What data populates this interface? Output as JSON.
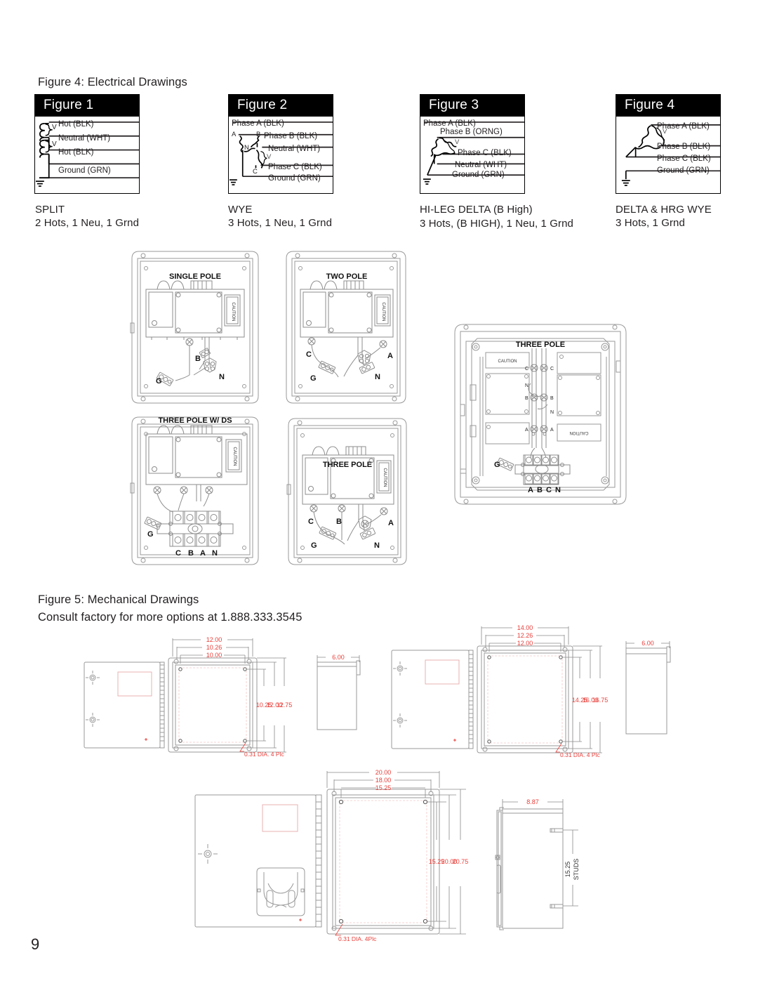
{
  "page": {
    "number": "9"
  },
  "figure4": {
    "caption": "Figure 4:  Electrical Drawings",
    "cards": [
      {
        "header": "Figure 1",
        "wires": [
          "Hot (BLK)",
          "Neutral (WHT)",
          "Hot (BLK)",
          "Ground (GRN)"
        ],
        "coil_marks": [
          "V",
          "V"
        ],
        "name": "SPLIT",
        "desc": "2 Hots, 1 Neu, 1 Grnd"
      },
      {
        "header": "Figure 2",
        "wires": [
          "Phase A (BLK)",
          "Phase B (BLK)",
          "Neutral (WHT)",
          "Phase C (BLK)",
          "Ground (GRN)"
        ],
        "node_marks": [
          "A",
          "B",
          "N",
          "C"
        ],
        "coil_marks": [
          "V"
        ],
        "name": "WYE",
        "desc": "3 Hots, 1 Neu, 1 Grnd"
      },
      {
        "header": "Figure 3",
        "wires": [
          "Phase A (BLK)",
          "Phase B (ORNG)",
          "Phase C (BLK)",
          "Neutral (WHT)",
          "Ground (GRN)"
        ],
        "coil_marks": [
          "V"
        ],
        "name": "HI-LEG DELTA (B High)",
        "desc": "3  Hots,  (B  HIGH),\n1 Neu, 1 Grnd"
      },
      {
        "header": "Figure 4",
        "wires": [
          "Phase A (BLK)",
          "Phase B (BLK)",
          "Phase C (BLK)",
          "Ground (GRN)"
        ],
        "coil_marks": [
          "V"
        ],
        "name": "DELTA & HRG WYE",
        "desc": "3 Hots, 1 Grnd"
      }
    ]
  },
  "panels": [
    {
      "title": "SINGLE POLE",
      "terminals": [
        "B"
      ],
      "ground": "G",
      "neutral": "N",
      "caution": "CAUTION"
    },
    {
      "title": "TWO POLE",
      "terminals": [
        "C",
        "A"
      ],
      "ground": "G",
      "neutral": "N",
      "caution": "CAUTION"
    },
    {
      "title": "THREE POLE W/ DS",
      "terminals": [
        "C",
        "B",
        "A",
        "N"
      ],
      "ground": "G",
      "neutral": "",
      "caution": "CAUTION"
    },
    {
      "title": "THREE POLE",
      "terminals": [
        "C",
        "B",
        "A"
      ],
      "ground": "G",
      "neutral": "N",
      "caution": "CAUTION"
    },
    {
      "title": "THREE POLE",
      "terminals": [
        "A",
        "B",
        "C",
        "N"
      ],
      "ground": "G",
      "neutral": "",
      "caution": "CAUTION",
      "side_labels": [
        "C",
        "C",
        "N",
        "B",
        "B",
        "N",
        "A",
        "A"
      ]
    }
  ],
  "figure5": {
    "caption": "Figure 5:  Mechanical Drawings",
    "subcaption": "Consult factory for more options at 1.888.333.3545",
    "drawings": [
      {
        "name": "small-enclosure",
        "width_dims": [
          "12.00",
          "10.26",
          "10.00"
        ],
        "height_dims": [
          "10.25",
          "12.00",
          "12.75"
        ],
        "depth_dim": "6.00",
        "hole_note": "0.31 DIA. 4 Plc"
      },
      {
        "name": "medium-enclosure",
        "width_dims": [
          "14.00",
          "12.26",
          "12.00"
        ],
        "height_dims": [
          "14.25",
          "16.00",
          "16.75"
        ],
        "depth_dim": "6.00",
        "hole_note": "0.31 DIA. 4 Plc"
      },
      {
        "name": "large-enclosure",
        "width_dims": [
          "20.00",
          "18.00",
          "15.25"
        ],
        "height_dims": [
          "15.25",
          "20.00",
          "20.75"
        ],
        "depth_dim": "8.87",
        "stud_dim": "15.25",
        "stud_label": "STUDS",
        "hole_note": "0.31 DIA. 4Plc"
      }
    ]
  },
  "colors": {
    "dimension_red": "#e8413c",
    "header_black": "#000000",
    "line_gray": "#8a8a8a",
    "text": "#231f20"
  }
}
